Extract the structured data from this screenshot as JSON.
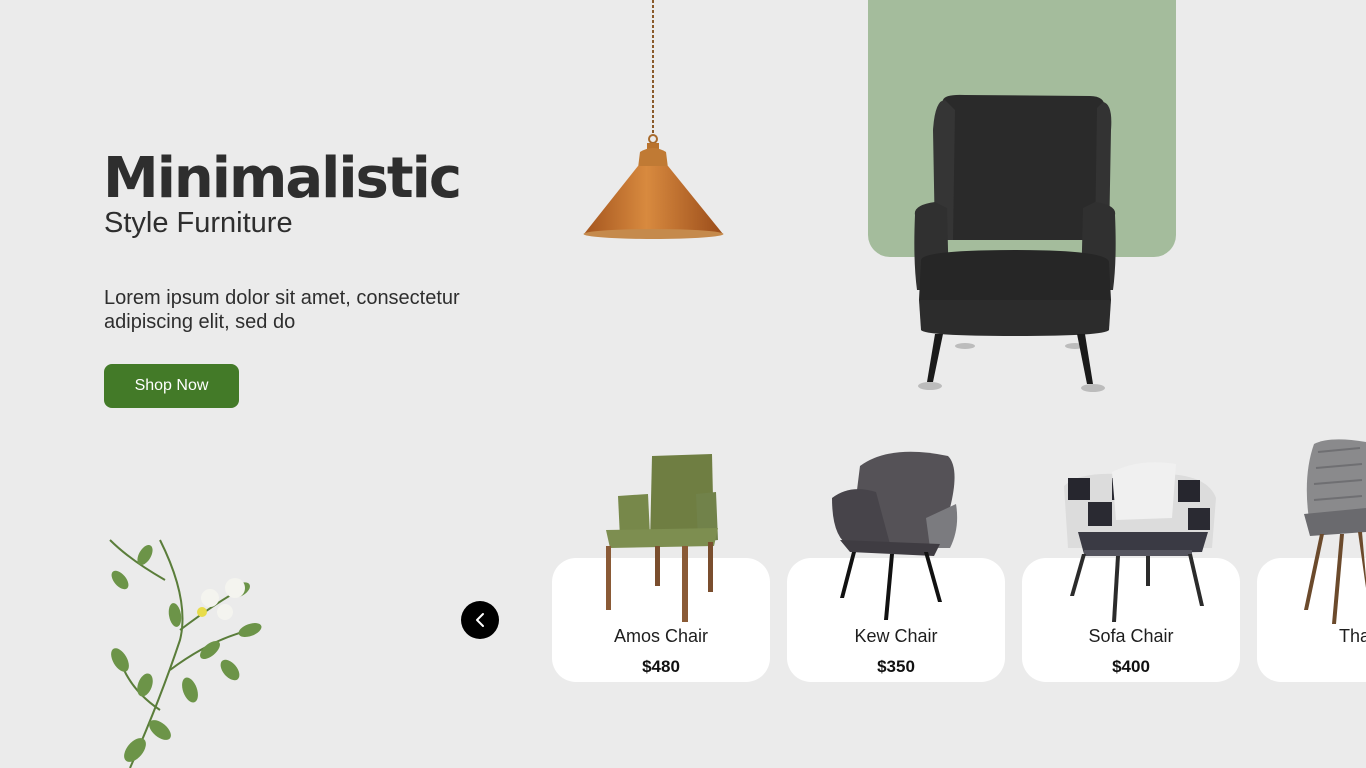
{
  "hero": {
    "title": "Minimalistic",
    "subtitle": "Style Furniture",
    "description": "Lorem ipsum dolor sit amet, consectetur adipiscing elit, sed do",
    "cta_label": "Shop Now"
  },
  "colors": {
    "accent": "#437a28",
    "panel": "#a4bc9c",
    "background": "#ebebeb"
  },
  "carousel": {
    "prev_icon": "chevron-left-icon",
    "products": [
      {
        "name": "Amos Chair",
        "price": "$480"
      },
      {
        "name": "Kew Chair",
        "price": "$350"
      },
      {
        "name": "Sofa Chair",
        "price": "$400"
      },
      {
        "name": "Tha",
        "price": ""
      }
    ]
  }
}
